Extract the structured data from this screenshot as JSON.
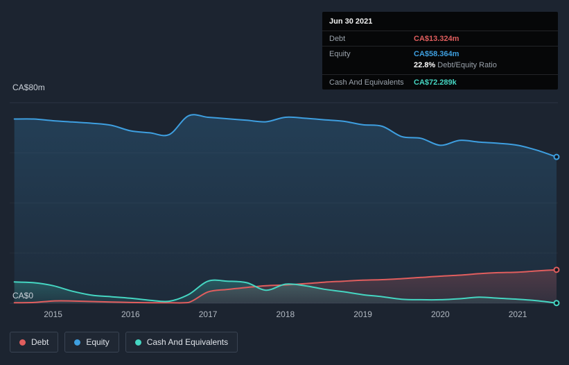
{
  "tooltip": {
    "date": "Jun 30 2021",
    "debt_label": "Debt",
    "debt_value": "CA$13.324m",
    "equity_label": "Equity",
    "equity_value": "CA$58.364m",
    "ratio_percent": "22.8%",
    "ratio_label": "Debt/Equity Ratio",
    "cash_label": "Cash And Equivalents",
    "cash_value": "CA$72.289k"
  },
  "axes": {
    "y_top_label": "CA$80m",
    "y_bottom_label": "CA$0"
  },
  "legend": {
    "items": [
      {
        "label": "Debt",
        "color": "#e15e5e"
      },
      {
        "label": "Equity",
        "color": "#3e9fe0"
      },
      {
        "label": "Cash And Equivalents",
        "color": "#45d6c2"
      }
    ]
  },
  "chart_data": {
    "type": "area",
    "unit": "CA$ millions",
    "x_range": [
      2014.44,
      2021.5
    ],
    "ylim": [
      0,
      80
    ],
    "grid_values": [
      0,
      20,
      40,
      60,
      80
    ],
    "x_ticks": [
      {
        "value": 2015,
        "label": "2015"
      },
      {
        "value": 2016,
        "label": "2016"
      },
      {
        "value": 2017,
        "label": "2017"
      },
      {
        "value": 2018,
        "label": "2018"
      },
      {
        "value": 2019,
        "label": "2019"
      },
      {
        "value": 2020,
        "label": "2020"
      },
      {
        "value": 2021,
        "label": "2021"
      }
    ],
    "x": [
      2014.5,
      2014.75,
      2015,
      2015.25,
      2015.5,
      2015.75,
      2016,
      2016.25,
      2016.5,
      2016.75,
      2017,
      2017.25,
      2017.5,
      2017.75,
      2018,
      2018.25,
      2018.5,
      2018.75,
      2019,
      2019.25,
      2019.5,
      2019.75,
      2020,
      2020.25,
      2020.5,
      2020.75,
      2021,
      2021.25,
      2021.5
    ],
    "series": [
      {
        "name": "Equity",
        "color": "#3e9fe0",
        "fill_top": 0.22,
        "fill_bottom": 0.06,
        "values": [
          73.5,
          73.5,
          72.8,
          72.3,
          71.8,
          71.0,
          68.8,
          68.0,
          67.3,
          74.8,
          74.2,
          73.6,
          73.0,
          72.4,
          74.2,
          73.8,
          73.2,
          72.6,
          71.2,
          70.6,
          66.5,
          65.8,
          63.0,
          65.0,
          64.3,
          63.8,
          63.0,
          61.0,
          58.364
        ]
      },
      {
        "name": "Debt",
        "color": "#e15e5e",
        "fill_top": 0.25,
        "fill_bottom": 0.1,
        "values": [
          0.2,
          0.3,
          0.9,
          0.9,
          0.7,
          0.5,
          0.3,
          0.2,
          0.2,
          0.3,
          4.5,
          5.5,
          6.3,
          7.0,
          7.3,
          7.8,
          8.4,
          8.8,
          9.2,
          9.4,
          9.8,
          10.3,
          10.8,
          11.2,
          11.8,
          12.2,
          12.4,
          12.9,
          13.324
        ]
      },
      {
        "name": "Cash And Equivalents",
        "color": "#45d6c2",
        "fill_top": 0.25,
        "fill_bottom": 0.08,
        "values": [
          8.5,
          8.2,
          7.0,
          4.8,
          3.2,
          2.6,
          2.0,
          1.2,
          0.8,
          3.5,
          8.8,
          8.8,
          8.2,
          5.2,
          7.6,
          7.0,
          5.6,
          4.6,
          3.4,
          2.6,
          1.6,
          1.4,
          1.4,
          1.8,
          2.4,
          2.0,
          1.6,
          1.0,
          0.072
        ]
      }
    ]
  }
}
